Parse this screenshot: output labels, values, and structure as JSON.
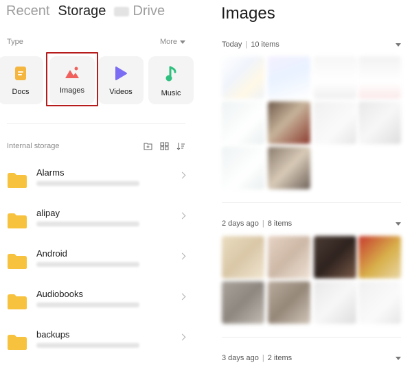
{
  "left": {
    "tabs": [
      {
        "label": "Recent"
      },
      {
        "label": "Storage"
      },
      {
        "label": "Drive"
      }
    ],
    "type_label": "Type",
    "more_label": "More",
    "categories": [
      {
        "label": "Docs",
        "icon": "document-icon",
        "color": "#f5b640"
      },
      {
        "label": "Images",
        "icon": "image-icon",
        "color": "#f0605c"
      },
      {
        "label": "Videos",
        "icon": "play-icon",
        "color": "#7b6cf4"
      },
      {
        "label": "Music",
        "icon": "music-note-icon",
        "color": "#2fc07f"
      }
    ],
    "internal_storage_label": "Internal storage",
    "folders": [
      {
        "name": "Alarms"
      },
      {
        "name": "alipay"
      },
      {
        "name": "Android"
      },
      {
        "name": "Audiobooks"
      },
      {
        "name": "backups"
      }
    ],
    "folder_color": "#f7c23e",
    "highlight_color": "#b71c1c"
  },
  "right": {
    "title": "Images",
    "sections": [
      {
        "date": "Today",
        "count": "10 items"
      },
      {
        "date": "2 days ago",
        "count": "8 items"
      },
      {
        "date": "3 days ago",
        "count": "2 items"
      }
    ]
  }
}
